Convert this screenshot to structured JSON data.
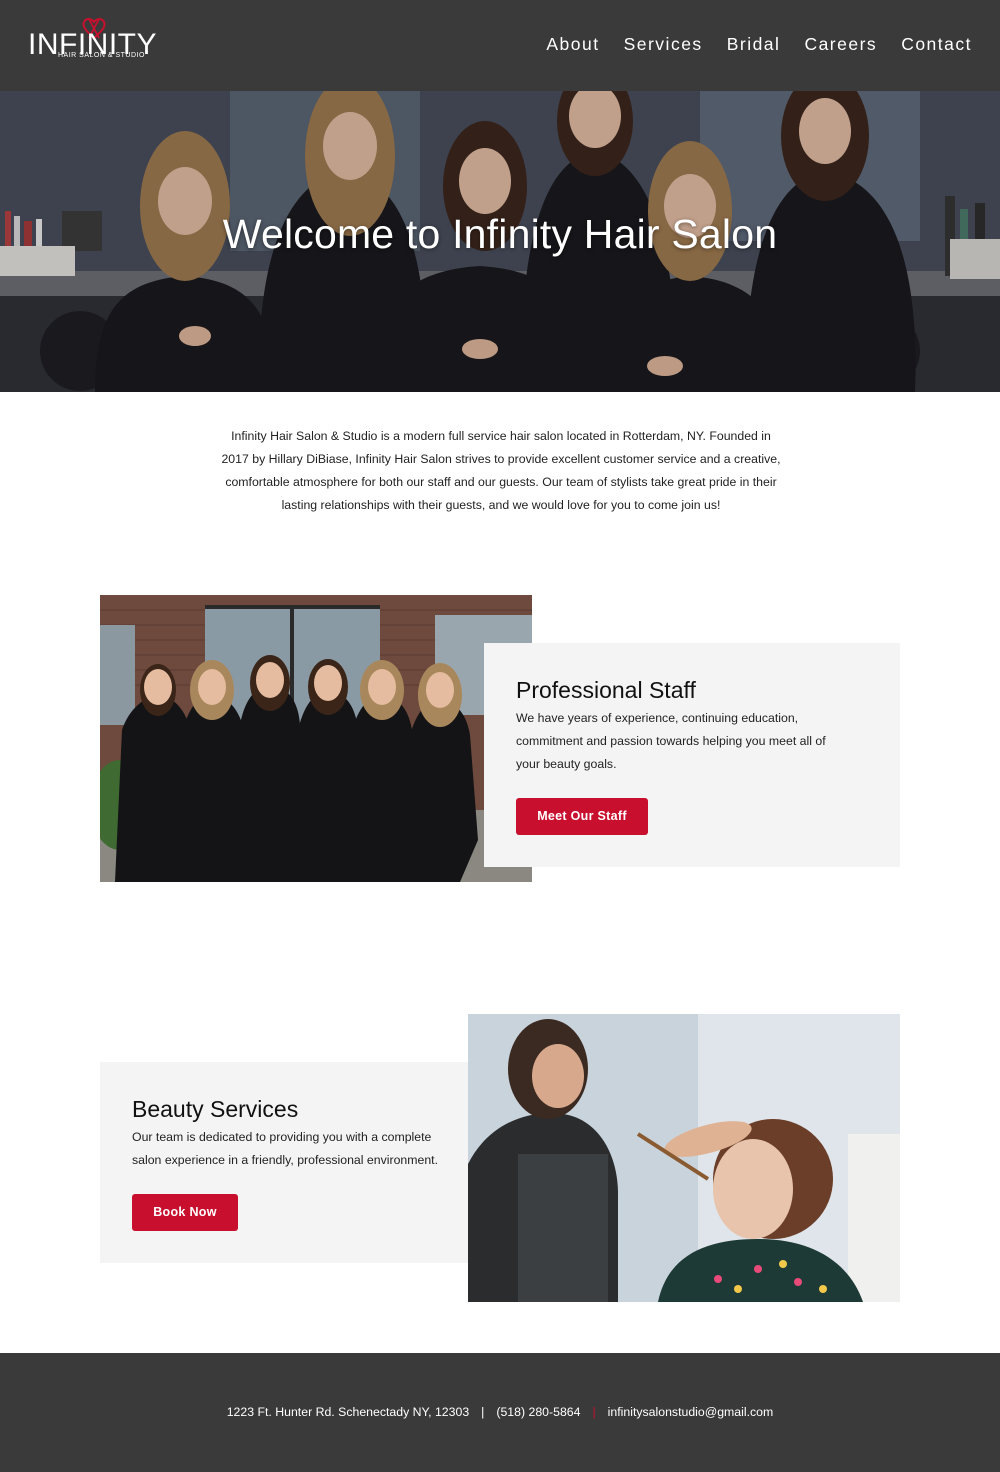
{
  "header": {
    "logo_text": "INFINITY",
    "logo_subtext": "HAIR SALON & STUDIO",
    "nav": [
      "About",
      "Services",
      "Bridal",
      "Careers",
      "Contact"
    ]
  },
  "hero": {
    "title": "Welcome to Infinity Hair Salon"
  },
  "intro": {
    "lines": [
      "Infinity Hair Salon & Studio is a modern full service hair salon located in Rotterdam, NY. Founded in",
      "2017 by Hillary DiBiase, Infinity Hair Salon strives to provide excellent customer service and a creative,",
      "comfortable atmosphere for both our staff and our guests. Our team of stylists take great pride in their",
      "lasting relationships with their guests, and we would love for you to come join us!"
    ]
  },
  "staff": {
    "title": "Professional Staff",
    "text_lines": [
      "We have years of experience, continuing education,",
      "commitment and passion towards helping you meet all of",
      "your beauty goals."
    ],
    "button": "Meet Our Staff"
  },
  "services": {
    "title": "Beauty Services",
    "text_lines": [
      "Our team is dedicated to providing you with a complete",
      "salon experience in a friendly, professional environment."
    ],
    "button": "Book Now"
  },
  "footer": {
    "address": "1223 Ft. Hunter Rd. Schenectady NY, 12303",
    "phone": "(518) 280-5864",
    "email": "infinitysalonstudio@gmail.com"
  },
  "colors": {
    "header_bg": "#3a3a3b",
    "accent": "#c8102e",
    "card_bg": "#f4f4f4"
  }
}
